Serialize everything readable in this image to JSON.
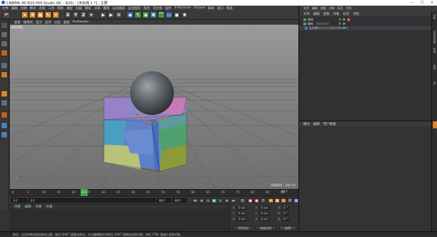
{
  "window": {
    "title": "CINEMA 4D R20.059 Studio (RC - R20) - [未标题 1 *] - 主要",
    "controls": [
      "—",
      "☐",
      "✕"
    ]
  },
  "menu": {
    "items": [
      "文件",
      "编辑",
      "创建",
      "模式",
      "选择",
      "工具",
      "网格",
      "捕捉",
      "动画",
      "模拟",
      "渲染",
      "雕刻",
      "运动跟踪",
      "运动图形",
      "角色",
      "流水线",
      "插件",
      "X-Particles",
      "Octane",
      "脚本",
      "窗口",
      "帮助"
    ],
    "right_label": "界面:",
    "right_value": "启动"
  },
  "toolbar": {
    "axis_x": "X",
    "axis_y": "Y",
    "axis_z": "Z"
  },
  "viewport": {
    "menu": [
      "查看",
      "摄像机",
      "显示",
      "选项",
      "过滤",
      "面板",
      "ProRender"
    ],
    "label": "透视视图",
    "grid_spacing": "网格间距 : 100 cm"
  },
  "timeline": {
    "ticks": [
      "0",
      "5",
      "10",
      "15",
      "20",
      "25",
      "30",
      "35",
      "40",
      "45",
      "50",
      "55",
      "60",
      "65",
      "70",
      "75",
      "80",
      "85",
      "90"
    ],
    "current_frame": "22 F",
    "end_frame": "90 F"
  },
  "transport": {
    "start": "0 F",
    "current": "0 F",
    "end": "90 F",
    "end2": "90 F"
  },
  "materials": {
    "menu": [
      "创建",
      "编辑",
      "功能",
      "纹理"
    ]
  },
  "coordinates": {
    "rows": [
      {
        "a": "X",
        "av": "0 cm",
        "b": "X",
        "bv": "0 cm",
        "c": "H",
        "cv": "0 °"
      },
      {
        "a": "Y",
        "av": "0 cm",
        "b": "Y",
        "bv": "0 cm",
        "c": "P",
        "cv": "0 °"
      },
      {
        "a": "Z",
        "av": "0 cm",
        "b": "Z",
        "bv": "0 cm",
        "c": "B",
        "cv": "0 °"
      }
    ],
    "mode_world": "世界坐标",
    "mode_scale": "缩放比例",
    "apply": "应用"
  },
  "status": {
    "text": "移动：点击并拖动鼠标移动元素。按住 SHIFT 键量化移动；节点编辑模式时按住 SHIFT 键增加选择对象；按住 CTRL 键减少选择对象。"
  },
  "object_manager": {
    "tabs": [
      "文件",
      "编辑",
      "查看",
      "对象",
      "标签",
      "书签"
    ],
    "menu": [
      "文件",
      "编辑",
      "查看",
      "对象",
      "标签",
      "书签"
    ],
    "objects": [
      {
        "name": "球体",
        "tag": ""
      },
      {
        "name": "破碎",
        "tag": "(Voronoi)"
      },
      {
        "name": "立方体",
        "tag": "(Voronoi) 破碎(Voronoi)"
      }
    ]
  },
  "attributes": {
    "menu": [
      "模式",
      "编辑",
      "用户数据"
    ]
  },
  "right_tabs": [
    "对象",
    "内容浏览器",
    "构造",
    "属性",
    "层"
  ],
  "colors": {
    "accent": "#d8862a",
    "play": "#3fa14a"
  }
}
